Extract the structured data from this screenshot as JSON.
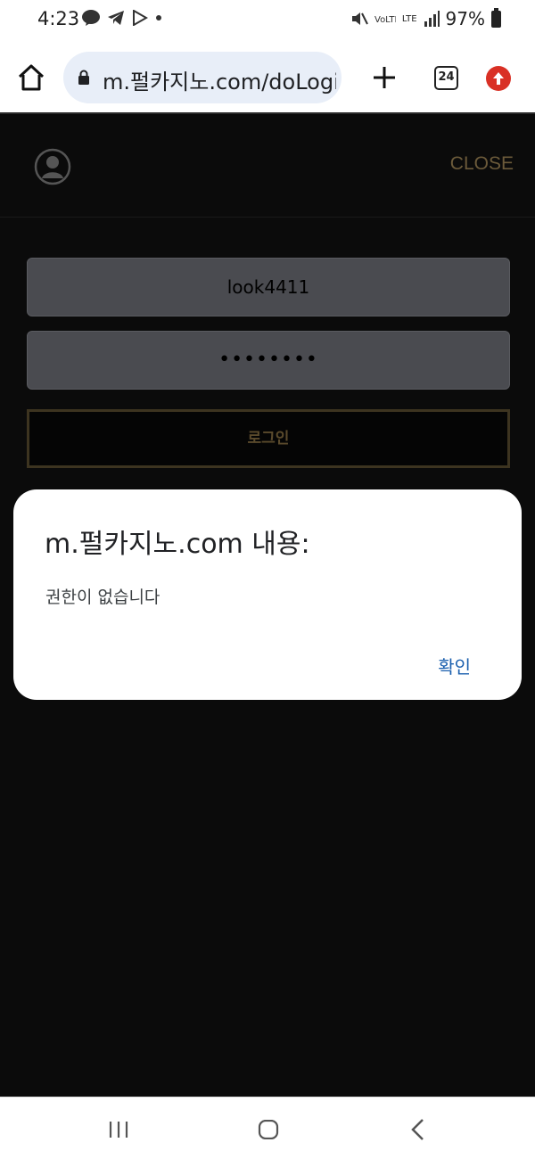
{
  "status_bar": {
    "time": "4:23",
    "battery": "97%",
    "network": "LTE"
  },
  "browser": {
    "url": "m.펄카지노.com/doLogin",
    "tab_count": "24"
  },
  "page": {
    "close_label": "CLOSE",
    "username_value": "look4411",
    "password_value": "••••••••",
    "login_label": "로그인"
  },
  "dialog": {
    "title": "m.펄카지노.com 내용:",
    "message": "권한이 없습니다",
    "ok_label": "확인"
  },
  "colors": {
    "accent_gold": "#6b5a3a",
    "dialog_button": "#1a5fae",
    "update_badge": "#d93025"
  }
}
